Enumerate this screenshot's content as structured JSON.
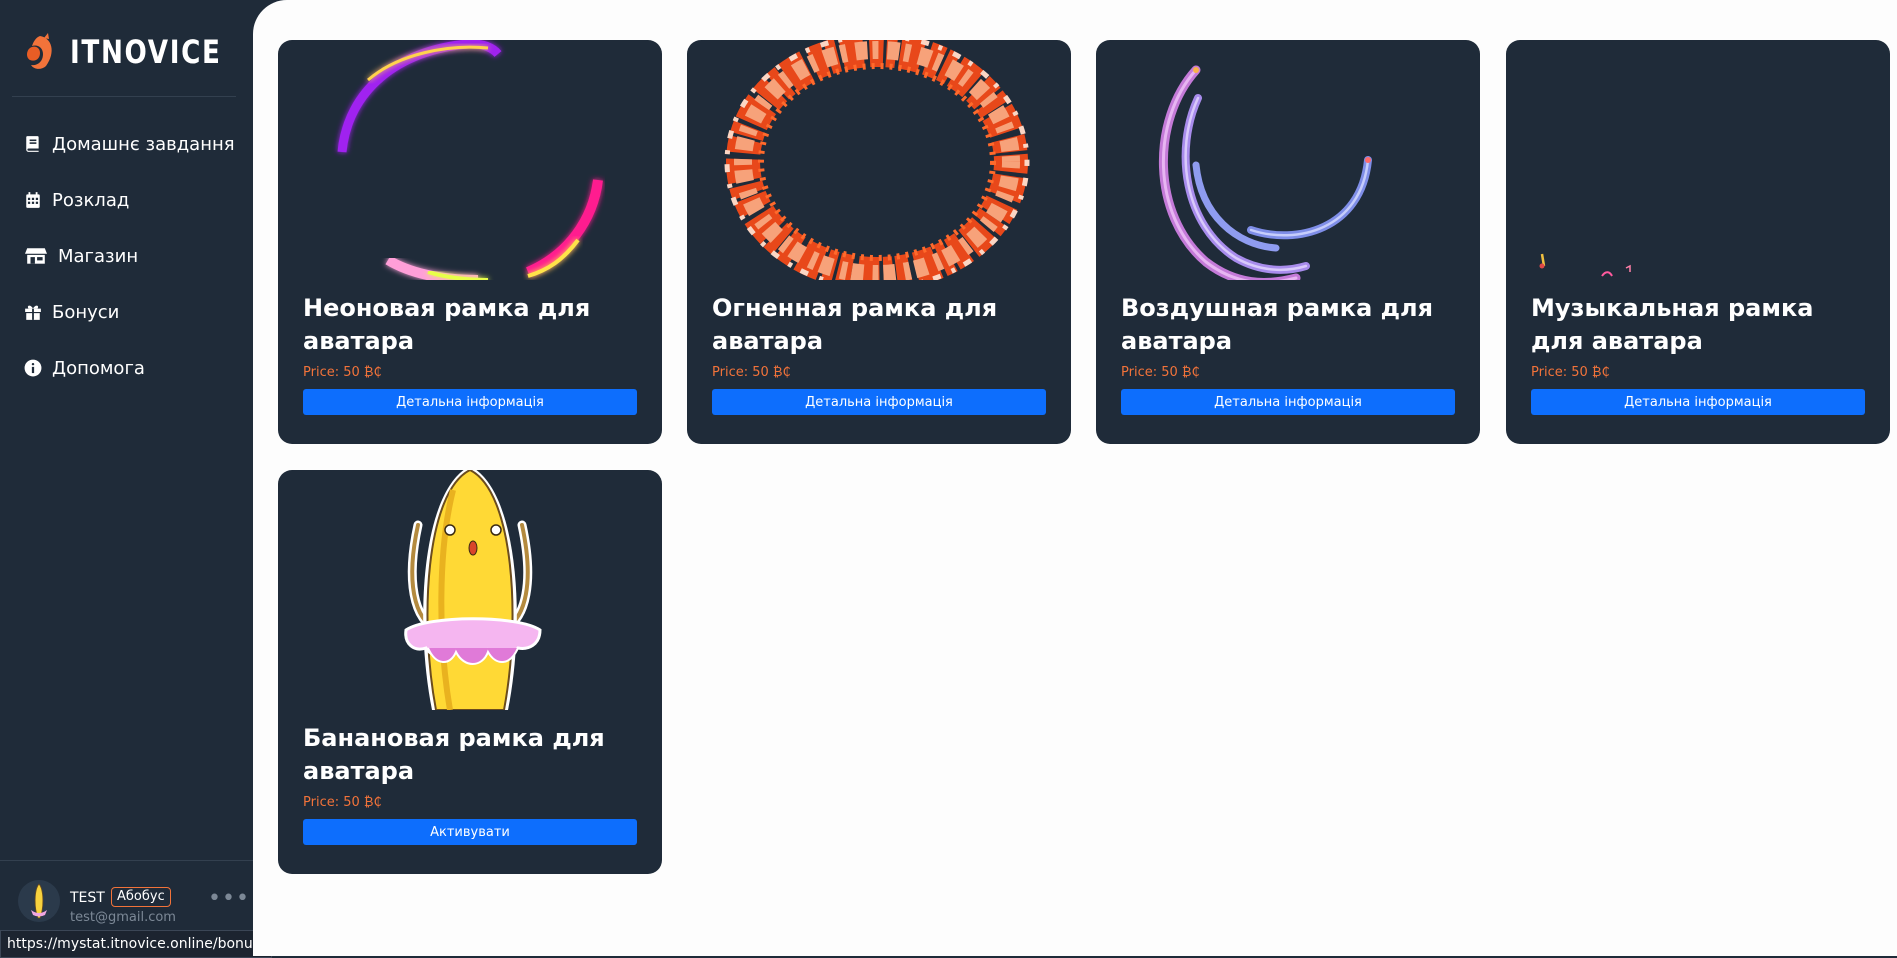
{
  "brand": {
    "name": "ITNOVICE"
  },
  "nav": [
    {
      "label": "Домашнє завдання",
      "icon": "book-icon"
    },
    {
      "label": "Розклад",
      "icon": "calendar-icon"
    },
    {
      "label": "Магазин",
      "icon": "shop-icon"
    },
    {
      "label": "Бонуси",
      "icon": "gift-icon"
    },
    {
      "label": "Допомога",
      "icon": "info-icon"
    }
  ],
  "user": {
    "name": "TEST",
    "badge": "Абобус",
    "email": "test@gmail.com",
    "menu": "•••"
  },
  "status_url": "https://mystat.itnovice.online/bonus/",
  "cards": [
    {
      "title": "Неоновая рамка для аватара",
      "price": "Price: 50 ₿₵",
      "button": "Детальна інформація",
      "art": "neon-frame"
    },
    {
      "title": "Огненная рамка для аватара",
      "price": "Price: 50 ₿₵",
      "button": "Детальна інформація",
      "art": "fire-frame"
    },
    {
      "title": "Воздушная рамка для аватара",
      "price": "Price: 50 ₿₵",
      "button": "Детальна інформація",
      "art": "air-frame"
    },
    {
      "title": "Музыкальная рамка для аватара",
      "price": "Price: 50 ₿₵",
      "button": "Детальна інформація",
      "art": "music-frame"
    },
    {
      "title": "Банановая рамка для аватара",
      "price": "Price: 50 ₿₵",
      "button": "Активувати",
      "art": "banana-frame"
    }
  ],
  "colors": {
    "sidebar_bg": "#1f2b39",
    "main_bg": "#fdfdfd",
    "card_bg": "#1f2b39",
    "accent_orange": "#f2733a",
    "button_blue": "#0d6efd"
  }
}
